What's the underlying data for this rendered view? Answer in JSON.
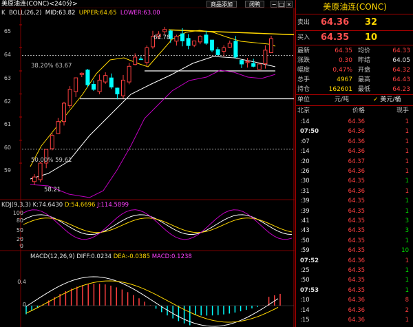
{
  "title_bar": {
    "symbol": "美原油连(CONC)<240分>",
    "btn_add": "商品添加",
    "btn_close": "闭鸭",
    "btn_min": "−",
    "btn_max": "□",
    "btn_x": "×"
  },
  "main": {
    "legend": {
      "k": "K",
      "boll": "BOLL(26,2)",
      "mid": "MID:63.82",
      "upper": "UPPER:64.65",
      "lower": "LOWER:63.00"
    },
    "price_axis": [
      "65",
      "64",
      "63",
      "62",
      "61",
      "60",
      "59"
    ],
    "annotations": {
      "high": "64.78",
      "low": "58.21",
      "fib_382": "38.20% 63.67",
      "fib_50": "50.00% 59.61"
    }
  },
  "kdj": {
    "legend": {
      "name": "KDJ(9,3,3)",
      "k": "K:74.6430",
      "d": "D:54.6696",
      "j": "J:114.5899"
    },
    "axis": [
      "100",
      "80",
      "50",
      "20",
      "0"
    ]
  },
  "macd": {
    "legend": {
      "name": "MACD(12,26,9)",
      "diff": "DIFF:0.0234",
      "dea": "DEA:-0.0385",
      "macd": "MACD:0.1238"
    },
    "axis": [
      "0.4",
      "0"
    ]
  },
  "colors": {
    "up": "#ff4040",
    "down": "#00ffff",
    "boll_upper": "#ffd700",
    "boll_mid": "#ffffff",
    "boll_lower": "#c000c0",
    "panel_border": "#aa0000"
  },
  "panel": {
    "title": "美原油连(CONC)",
    "sell": {
      "label": "卖出",
      "price": "64.36",
      "volume": "32"
    },
    "buy": {
      "label": "买入",
      "price": "64.35",
      "volume": "10"
    },
    "stats": [
      {
        "l1": "最新",
        "v1": "64.35",
        "l2": "均价",
        "v2": "64.33"
      },
      {
        "l1": "涨跌",
        "v1": "0.30",
        "l2": "昨结",
        "v2": "64.05"
      },
      {
        "l1": "幅度",
        "v1": "0.47%",
        "l2": "开盘",
        "v2": "64.32"
      },
      {
        "l1": "总手",
        "v1": "4967",
        "l2": "最高",
        "v2": "64.43"
      },
      {
        "l1": "持仓",
        "v1": "162601",
        "l2": "最低",
        "v2": "64.23"
      }
    ],
    "unit": {
      "label": "单位",
      "value": "元/吨",
      "currency": "美元/桶"
    },
    "ticks_header": {
      "time": "北京",
      "price": "价格",
      "vol": "现手"
    },
    "ticks": [
      {
        "time": ":14",
        "price": "64.36",
        "vol": "1"
      },
      {
        "time": "07:50",
        "price": "64.36",
        "vol": "1"
      },
      {
        "time": ":07",
        "price": "64.36",
        "vol": "1"
      },
      {
        "time": ":14",
        "price": "64.36",
        "vol": "1"
      },
      {
        "time": ":20",
        "price": "64.37",
        "vol": "1"
      },
      {
        "time": ":26",
        "price": "64.36",
        "vol": "1"
      },
      {
        "time": ":30",
        "price": "64.35",
        "vol": "1"
      },
      {
        "time": ":31",
        "price": "64.36",
        "vol": "1"
      },
      {
        "time": ":39",
        "price": "64.35",
        "vol": "1"
      },
      {
        "time": ":39",
        "price": "64.35",
        "vol": "1"
      },
      {
        "time": ":41",
        "price": "64.35",
        "vol": "3"
      },
      {
        "time": ":43",
        "price": "64.35",
        "vol": "3"
      },
      {
        "time": ":50",
        "price": "64.35",
        "vol": "1"
      },
      {
        "time": ":59",
        "price": "64.35",
        "vol": "10"
      },
      {
        "time": "07:52",
        "price": "64.36",
        "vol": "1"
      },
      {
        "time": ":25",
        "price": "64.35",
        "vol": "1"
      },
      {
        "time": ":50",
        "price": "64.35",
        "vol": "1"
      },
      {
        "time": "07:53",
        "price": "64.35",
        "vol": "1"
      },
      {
        "time": ":10",
        "price": "64.36",
        "vol": "8"
      },
      {
        "time": ":14",
        "price": "64.36",
        "vol": "2"
      },
      {
        "time": ":15",
        "price": "64.36",
        "vol": "1"
      }
    ]
  }
}
